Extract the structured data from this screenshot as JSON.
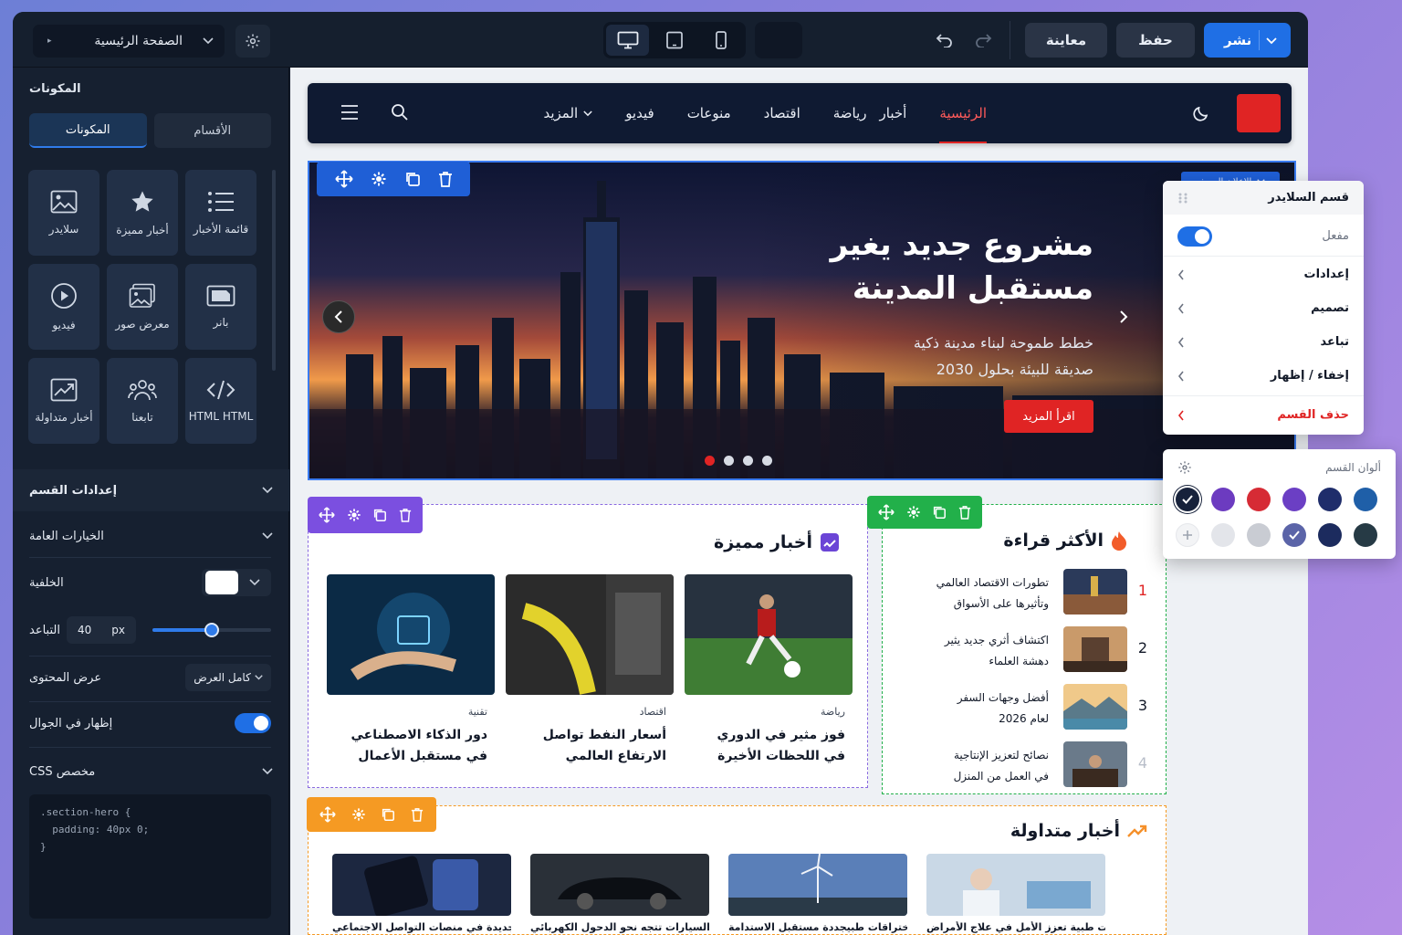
{
  "topbar": {
    "page_select": "الصفحة الرئيسية",
    "preview_label": "معاينة",
    "save_label": "حفظ",
    "publish_label": "نشر"
  },
  "sidebar": {
    "title": "المكونات",
    "tabs": [
      "المكونات",
      "الأقسام"
    ],
    "widgets": [
      {
        "label": "سلايدر",
        "icon": "image-icon"
      },
      {
        "label": "أخبار مميزة",
        "icon": "star-icon"
      },
      {
        "label": "قائمة الأخبار",
        "icon": "list-icon"
      },
      {
        "label": "فيديو",
        "icon": "play-icon"
      },
      {
        "label": "معرض صور",
        "icon": "gallery-icon"
      },
      {
        "label": "بانر",
        "icon": "banner-icon"
      },
      {
        "label": "أخبار متداولة",
        "icon": "trending-icon"
      },
      {
        "label": "تابعنا",
        "icon": "users-icon"
      },
      {
        "label": "HTML HTML",
        "icon": "code-icon"
      }
    ],
    "section_settings": "إعدادات القسم",
    "general_options": "الخيارات العامة",
    "background_label": "الخلفية",
    "background_color": "#ffffff",
    "spacing_label": "التباعد",
    "spacing_value": "40",
    "spacing_unit": "px",
    "spacing_fraction": 0.5,
    "content_width_label": "عرض المحتوى",
    "content_width_value": "كامل العرض",
    "mobile_label": "إظهار في الجوال",
    "mobile_on": true,
    "css_label": "CSS مخصص",
    "css_lines": [
      ".section-hero {",
      "  padding: 40px 0;",
      "}"
    ]
  },
  "site": {
    "nav": [
      "الرئيسية",
      "أخبار",
      "رياضة",
      "اقتصاد",
      "منوعات",
      "فيديو",
      "المزيد"
    ],
    "hero": {
      "title_line1": "مشروع جديد يغير",
      "title_line2": "مستقبل المدينة",
      "sub_line1": "خطط طموحة لبناء مدينة ذكية",
      "sub_line2": "صديقة للبيئة بحلول 2030",
      "cta": "اقرأ المزيد",
      "label": "الإعلان المصغر"
    },
    "featured": {
      "title": "أخبار مميزة",
      "cards": [
        {
          "cat": "رياضة",
          "l1": "فوز مثير في الدوري",
          "l2": "في اللحظات الأخيرة"
        },
        {
          "cat": "اقتصاد",
          "l1": "أسعار النفط تواصل",
          "l2": "الارتفاع العالمي"
        },
        {
          "cat": "تقنية",
          "l1": "دور الذكاء الاصطناعي",
          "l2": "في مستقبل الأعمال"
        }
      ]
    },
    "most_read": {
      "title": "الأكثر قراءة",
      "items": [
        {
          "n": "1",
          "l1": "تطورات الاقتصاد العالمي",
          "l2": "وتأثيرها على الأسواق"
        },
        {
          "n": "2",
          "l1": "اكتشاف أثري جديد يثير",
          "l2": "دهشة العلماء"
        },
        {
          "n": "3",
          "l1": "أفضل وجهات السفر",
          "l2": "لعام 2026"
        },
        {
          "n": "4",
          "l1": "نصائح لتعزيز الإنتاجية",
          "l2": "في العمل من المنزل"
        }
      ]
    },
    "trending": {
      "title": "أخبار متداولة",
      "items": [
        "اختراقات طبية تعزز الأمل في علاج الأمراض",
        "اختراقات طبيجددة مستقبل الاستدامة",
        "شركات السيارات تتجه نحو الدحول الكهربائي",
        "تحديثات جديدة في منصات التواصل الاجتماعي"
      ]
    }
  },
  "context_menu": {
    "title": "قسم السلايدر",
    "enabled_label": "مفعل",
    "items": [
      "إعدادات",
      "تصميم",
      "تباعد",
      "إخفاء / إظهار"
    ],
    "delete_label": "حذف القسم"
  },
  "colors_panel": {
    "title": "ألوان القسم",
    "swatches": [
      "#1f5fa8",
      "#1f2d6b",
      "#6b3fc4",
      "#d62b35",
      "#6c3bc0",
      "#17223b",
      "#263a45",
      "#1c2b5e",
      "#5b64a8",
      "#c9ccd3",
      "#e3e5ea",
      "#ffffff"
    ]
  }
}
